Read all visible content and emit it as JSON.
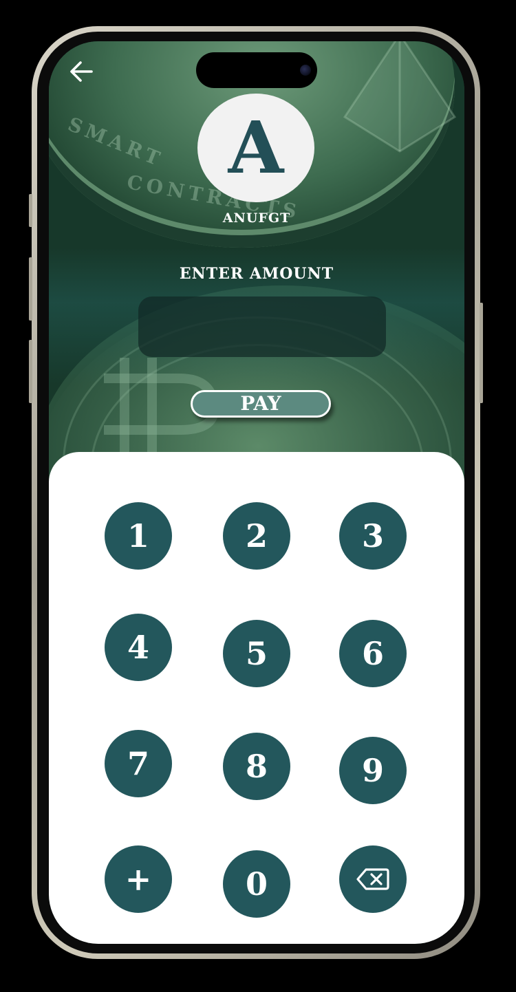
{
  "header": {
    "back_icon": "arrow-left-icon"
  },
  "profile": {
    "avatar_letter": "A",
    "username": "ANUFGT"
  },
  "amount": {
    "label": "ENTER AMOUNT",
    "value": "",
    "placeholder": ""
  },
  "pay_button": {
    "label": "PAY"
  },
  "keypad": {
    "keys": [
      "1",
      "2",
      "3",
      "4",
      "5",
      "6",
      "7",
      "8",
      "9",
      "+",
      "0"
    ],
    "backspace_icon": "backspace-icon"
  },
  "colors": {
    "accent": "#23575c",
    "pay_button": "#5c8a80",
    "panel": "#ffffff",
    "background": "#1b3a2e"
  }
}
